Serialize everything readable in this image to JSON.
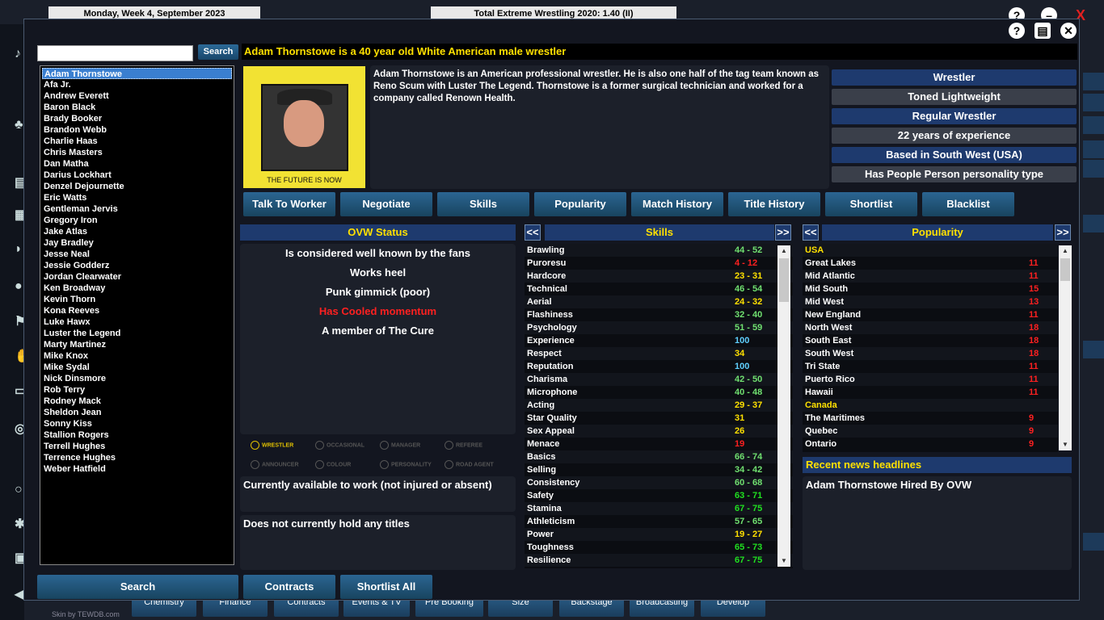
{
  "app": {
    "date_label": "Monday, Week 4, September 2023",
    "title_label": "Total Extreme Wrestling 2020: 1.40 (II)",
    "skin_label": "Skin by TEWDB.com",
    "bottom_tabs": [
      "Chemistry",
      "Finance",
      "Contracts",
      "Events & TV",
      "Pre Booking",
      "Size",
      "Backstage",
      "Broadcasting",
      "Develop"
    ]
  },
  "search": {
    "value": "",
    "button_label": "Search"
  },
  "names": [
    "Adam Thornstowe",
    "Afa Jr.",
    "Andrew Everett",
    "Baron Black",
    "Brady Booker",
    "Brandon Webb",
    "Charlie Haas",
    "Chris Masters",
    "Dan Matha",
    "Darius Lockhart",
    "Denzel Dejournette",
    "Eric Watts",
    "Gentleman Jervis",
    "Gregory Iron",
    "Jake Atlas",
    "Jay Bradley",
    "Jesse Neal",
    "Jessie Godderz",
    "Jordan Clearwater",
    "Ken Broadway",
    "Kevin Thorn",
    "Kona Reeves",
    "Luke Hawx",
    "Luster the Legend",
    "Marty Martinez",
    "Mike Knox",
    "Mike Sydal",
    "Nick Dinsmore",
    "Rob Terry",
    "Rodney Mack",
    "Sheldon Jean",
    "Sonny Kiss",
    "Stallion Rogers",
    "Terrell Hughes",
    "Terrence Hughes",
    "Weber Hatfield"
  ],
  "worker": {
    "headline": "Adam Thornstowe is a 40 year old White American male wrestler",
    "photo_caption": "THE FUTURE IS NOW",
    "bio": "Adam Thornstowe is an American professional wrestler. He is also one half of the tag team known as Reno Scum with Luster The Legend. Thornstowe is a former surgical technician and worked for a company called Renown Health.",
    "attributes": [
      "Wrestler",
      "Toned Lightweight",
      "Regular Wrestler",
      "22 years of experience",
      "Based in South West (USA)",
      "Has People Person personality type"
    ]
  },
  "tabs": [
    "Talk To Worker",
    "Negotiate",
    "Skills",
    "Popularity",
    "Match History",
    "Title History",
    "Shortlist",
    "Blacklist"
  ],
  "status": {
    "title": "OVW Status",
    "lines": [
      {
        "text": "Is considered well known by the fans",
        "color": "#ffffff"
      },
      {
        "text": "Works heel",
        "color": "#ffffff"
      },
      {
        "text": "Punk gimmick (poor)",
        "color": "#ffffff"
      },
      {
        "text": "Has Cooled momentum",
        "color": "#ff2020"
      },
      {
        "text": "A member of The Cure",
        "color": "#ffffff"
      }
    ],
    "roles": [
      "WRESTLER",
      "OCCASIONAL",
      "MANAGER",
      "REFEREE",
      "ANNOUNCER",
      "COLOUR",
      "PERSONALITY",
      "ROAD AGENT"
    ],
    "availability": "Currently available to work (not injured or absent)",
    "titles": "Does not currently hold any titles"
  },
  "skills": {
    "title": "Skills",
    "prev": "<<",
    "next": ">>",
    "rows": [
      {
        "name": "Brawling",
        "value": "44 - 52",
        "color": "#70e070"
      },
      {
        "name": "Puroresu",
        "value": "4 - 12",
        "color": "#ff2020"
      },
      {
        "name": "Hardcore",
        "value": "23 - 31",
        "color": "#ffe000"
      },
      {
        "name": "Technical",
        "value": "46 - 54",
        "color": "#70e070"
      },
      {
        "name": "Aerial",
        "value": "24 - 32",
        "color": "#ffe000"
      },
      {
        "name": "Flashiness",
        "value": "32 - 40",
        "color": "#70e070"
      },
      {
        "name": "Psychology",
        "value": "51 - 59",
        "color": "#70e070"
      },
      {
        "name": "Experience",
        "value": "100",
        "color": "#60d0ff"
      },
      {
        "name": "Respect",
        "value": "34",
        "color": "#ffe000"
      },
      {
        "name": "Reputation",
        "value": "100",
        "color": "#60d0ff"
      },
      {
        "name": "Charisma",
        "value": "42 - 50",
        "color": "#70e070"
      },
      {
        "name": "Microphone",
        "value": "40 - 48",
        "color": "#70e070"
      },
      {
        "name": "Acting",
        "value": "29 - 37",
        "color": "#ffe000"
      },
      {
        "name": "Star Quality",
        "value": "31",
        "color": "#ffe000"
      },
      {
        "name": "Sex Appeal",
        "value": "26",
        "color": "#ffe000"
      },
      {
        "name": "Menace",
        "value": "19",
        "color": "#ff2020"
      },
      {
        "name": "Basics",
        "value": "66 - 74",
        "color": "#70e070"
      },
      {
        "name": "Selling",
        "value": "34 - 42",
        "color": "#70e070"
      },
      {
        "name": "Consistency",
        "value": "60 - 68",
        "color": "#70e070"
      },
      {
        "name": "Safety",
        "value": "63 - 71",
        "color": "#20e020"
      },
      {
        "name": "Stamina",
        "value": "67 - 75",
        "color": "#20e020"
      },
      {
        "name": "Athleticism",
        "value": "57 - 65",
        "color": "#70e070"
      },
      {
        "name": "Power",
        "value": "19 - 27",
        "color": "#ffe000"
      },
      {
        "name": "Toughness",
        "value": "65 - 73",
        "color": "#20e020"
      },
      {
        "name": "Resilience",
        "value": "67 - 75",
        "color": "#20e020"
      }
    ]
  },
  "popularity": {
    "title": "Popularity",
    "prev": "<<",
    "next": ">>",
    "rows": [
      {
        "name": "USA",
        "value": "",
        "header": true
      },
      {
        "name": "Great Lakes",
        "value": "11"
      },
      {
        "name": "Mid Atlantic",
        "value": "11"
      },
      {
        "name": "Mid South",
        "value": "15"
      },
      {
        "name": "Mid West",
        "value": "13"
      },
      {
        "name": "New England",
        "value": "11"
      },
      {
        "name": "North West",
        "value": "18"
      },
      {
        "name": "South East",
        "value": "18"
      },
      {
        "name": "South West",
        "value": "18"
      },
      {
        "name": "Tri State",
        "value": "11"
      },
      {
        "name": "Puerto Rico",
        "value": "11"
      },
      {
        "name": "Hawaii",
        "value": "11"
      },
      {
        "name": "Canada",
        "value": "",
        "header": true
      },
      {
        "name": "The Maritimes",
        "value": "9"
      },
      {
        "name": "Quebec",
        "value": "9"
      },
      {
        "name": "Ontario",
        "value": "9"
      }
    ]
  },
  "news": {
    "title": "Recent news headlines",
    "items": [
      "Adam Thornstowe Hired By OVW"
    ]
  },
  "bottom": {
    "search": "Search",
    "contracts": "Contracts",
    "shortlist_all": "Shortlist All"
  },
  "colors": {
    "accent_blue": "#1e3a6e",
    "headline_yellow": "#ffe000",
    "bad_red": "#ff2020",
    "great_cyan": "#60d0ff"
  }
}
